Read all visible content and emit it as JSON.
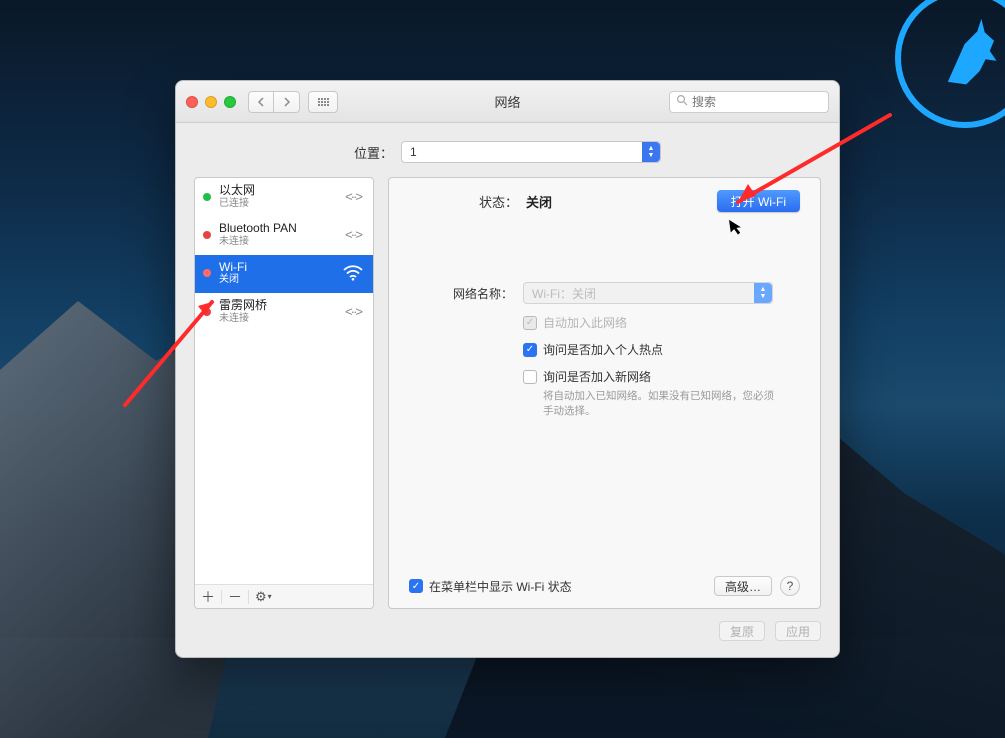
{
  "window": {
    "title": "网络",
    "search_placeholder": "搜索"
  },
  "location": {
    "label": "位置：",
    "value": "1"
  },
  "sidebar": {
    "items": [
      {
        "name": "以太网",
        "sub": "已连接",
        "status": "green",
        "icon": "conn"
      },
      {
        "name": "Bluetooth PAN",
        "sub": "未连接",
        "status": "red",
        "icon": "conn"
      },
      {
        "name": "Wi-Fi",
        "sub": "关闭",
        "status": "red",
        "icon": "wifi",
        "selected": true
      },
      {
        "name": "雷雳网桥",
        "sub": "未连接",
        "status": "red",
        "icon": "conn"
      }
    ],
    "add": "＋",
    "remove": "－",
    "gear": "⚙"
  },
  "detail": {
    "status_label": "状态：",
    "status_value": "关闭",
    "open_btn": "打开 Wi-Fi",
    "network_name_label": "网络名称：",
    "network_name_value": "Wi-Fi：关闭",
    "auto_join": "自动加入此网络",
    "ask_hotspot": "询问是否加入个人热点",
    "ask_new": "询问是否加入新网络",
    "hint": "将自动加入已知网络。如果没有已知网络，您必须手动选择。",
    "menubar": "在菜单栏中显示 Wi-Fi 状态",
    "advanced": "高级…",
    "help": "?"
  },
  "footer": {
    "revert": "复原",
    "apply": "应用"
  }
}
